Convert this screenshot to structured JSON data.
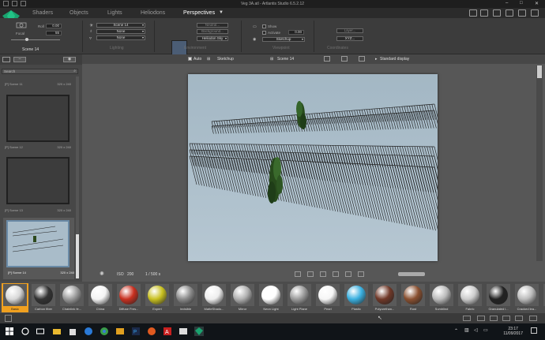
{
  "window": {
    "title": "Veg 3A.atl - Artlantis Studio 6.5.2.12"
  },
  "tabs": [
    {
      "label": "Shaders",
      "active": false
    },
    {
      "label": "Objects",
      "active": false
    },
    {
      "label": "Lights",
      "active": false
    },
    {
      "label": "Heliodons",
      "active": false
    },
    {
      "label": "Perspectives",
      "active": true
    }
  ],
  "toolbar": {
    "roll_label": "Roll",
    "roll_value": "0.00",
    "focal_label": "Focal",
    "focal_value": "55",
    "scene_name": "Scene 14",
    "lighting_combo_1": "Scene 14",
    "lighting_combo_2": "None",
    "lighting_combo_3": "None",
    "lighting_section": "Lighting",
    "env_field_1": "Neutral...",
    "env_field_2": "Background...",
    "env_combo": "Heliodon Sky",
    "env_section": "Environment",
    "show_label": "Show",
    "activate_label": "Activate",
    "activate_value": "0.00",
    "vr_combo": "Sketchup",
    "viewpoint_section": "Viewpoint",
    "coord_field_1": "Layer...",
    "coord_field_2": "XYZ...",
    "coord_section": "Coordinates"
  },
  "left_panel": {
    "search_placeholder": "Search",
    "scenes": [
      {
        "name": "[P] Scene 11",
        "size": "320 x 240"
      },
      {
        "name": "[P] Scene 12",
        "size": "320 x 240"
      },
      {
        "name": "[P] Scene 13",
        "size": "320 x 240"
      },
      {
        "name": "[P] Scene 14",
        "size": "320 x 240"
      }
    ]
  },
  "viewport": {
    "auto_label": "Auto",
    "source_label": "Sketchup",
    "scene_label": "Scene 14",
    "display_label": "Standard display",
    "iso_label": "ISO",
    "iso_value": "200",
    "shutter_label": "1 / 500 s"
  },
  "shaders": [
    {
      "label": "Basic",
      "color": "#d8d8d8"
    },
    {
      "label": "Carbon fiber",
      "color": "#333333"
    },
    {
      "label": "Chainlink fe...",
      "color": "#9a9a9a"
    },
    {
      "label": "China",
      "color": "#f4f4f4"
    },
    {
      "label": "Diffuse Fres...",
      "color": "#c83020"
    },
    {
      "label": "Expert",
      "color": "#c8c020"
    },
    {
      "label": "Invisible",
      "color": "#8a8a8a"
    },
    {
      "label": "MatteShado...",
      "color": "#eeeeee"
    },
    {
      "label": "Mirror",
      "color": "#b0b0b0"
    },
    {
      "label": "Neon Light",
      "color": "#ffffff"
    },
    {
      "label": "Light Plane",
      "color": "#9a9a9a"
    },
    {
      "label": "Pearl",
      "color": "#f6f6f6"
    },
    {
      "label": "Plastic",
      "color": "#3ab0e0"
    },
    {
      "label": "Polyurethan...",
      "color": "#703828"
    },
    {
      "label": "Rust",
      "color": "#8a5030"
    },
    {
      "label": "Sumblind",
      "color": "#bbbbbb"
    },
    {
      "label": "Fabric",
      "color": "#cccccc"
    },
    {
      "label": "Granulated l...",
      "color": "#222222"
    },
    {
      "label": "Cracked lea...",
      "color": "#bbbbbb"
    },
    {
      "label": "Le...",
      "color": "#444444"
    }
  ],
  "taskbar": {
    "time": "23:17",
    "date": "11/09/2017"
  },
  "colors": {
    "active_tab_text": "#ffffff",
    "shader_selected": "#f0a020",
    "render_sky": "#a9bcc8"
  }
}
